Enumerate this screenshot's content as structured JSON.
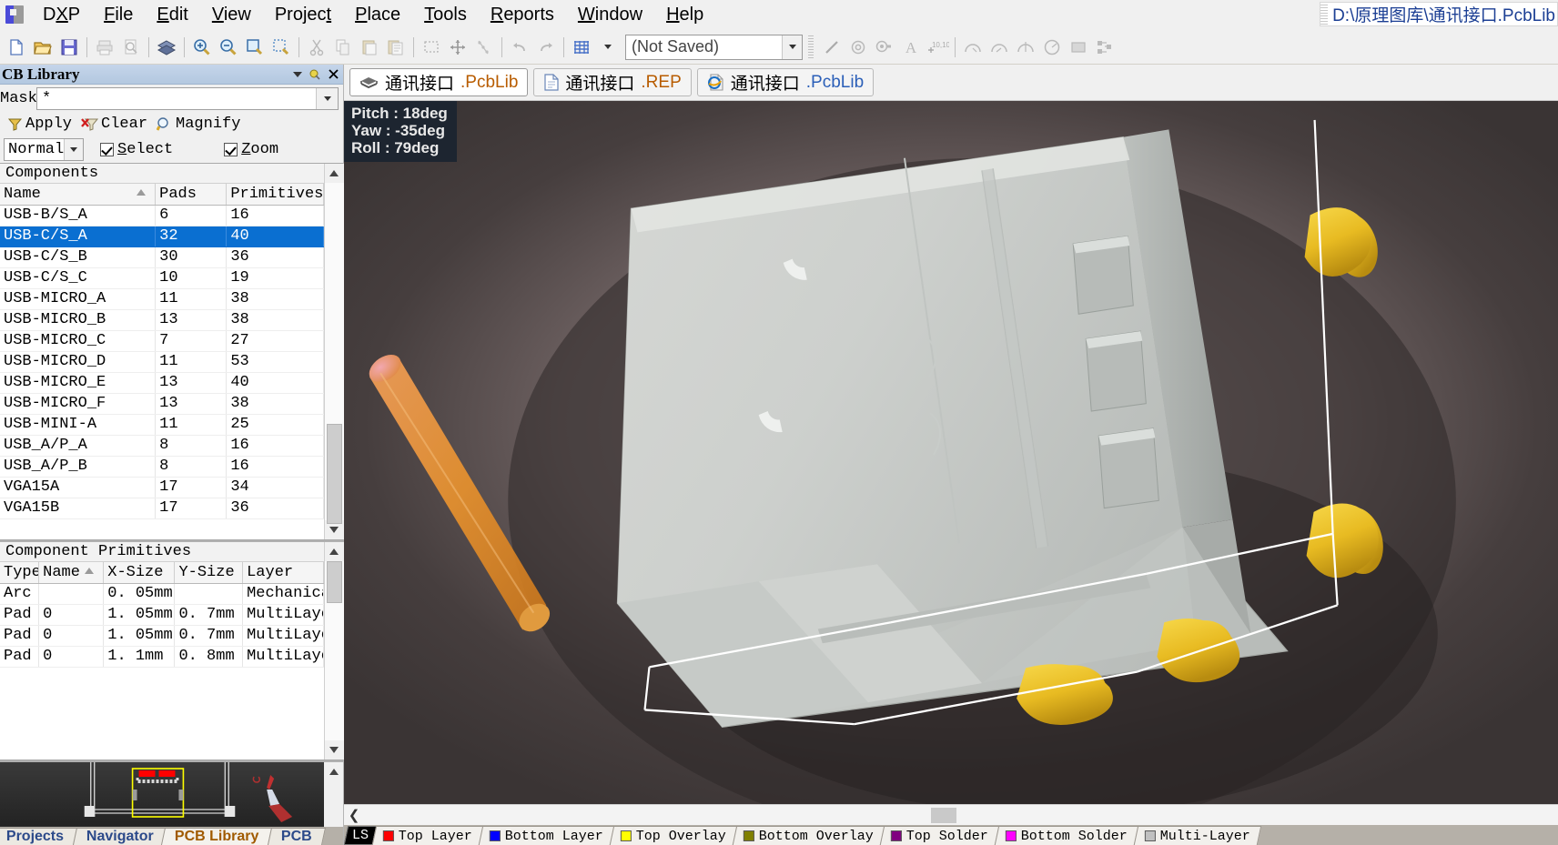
{
  "window": {
    "file_path": "D:\\原理图库\\通讯接口.PcbLib"
  },
  "menu": {
    "items": [
      "DXP",
      "File",
      "Edit",
      "View",
      "Project",
      "Place",
      "Tools",
      "Reports",
      "Window",
      "Help"
    ]
  },
  "toolbar": {
    "layer_combo_value": "(Not Saved)",
    "icons": [
      "new-document-icon",
      "open-folder-icon",
      "save-icon",
      "print-icon",
      "print-preview-icon",
      "board-3d-icon",
      "zoom-in-icon",
      "zoom-out-icon",
      "zoom-area-icon",
      "zoom-selection-icon",
      "cut-icon",
      "copy-icon",
      "paste-icon",
      "paste-special-icon",
      "select-area-icon",
      "move-icon",
      "align-icon",
      "undo-icon",
      "redo-icon",
      "grid-icon",
      "line-icon",
      "via-icon",
      "pad-icon",
      "text-icon",
      "coordinate-icon",
      "arc-center-icon",
      "arc-edge-icon",
      "arc-any-angle-icon",
      "full-circle-icon",
      "fill-icon",
      "array-paste-icon"
    ]
  },
  "panel": {
    "title": "CB Library",
    "mask": {
      "label": "Mask",
      "value": "*"
    },
    "buttons": [
      {
        "label": "Apply",
        "icon": "filter-icon"
      },
      {
        "label": "Clear",
        "icon": "clear-filter-icon"
      },
      {
        "label": "Magnify",
        "icon": "magnify-icon"
      }
    ],
    "mode_combo_value": "Normal",
    "checkboxes": [
      {
        "label": "Select",
        "checked": true
      },
      {
        "label": "Zoom",
        "checked": true
      }
    ],
    "components_grid": {
      "caption": "Components",
      "columns": [
        "Name",
        "Pads",
        "Primitives"
      ],
      "sorted_column": "Name",
      "selected_index": 1,
      "rows": [
        {
          "name": "USB-B/S_A",
          "pads": "6",
          "primitives": "16"
        },
        {
          "name": "USB-C/S_A",
          "pads": "32",
          "primitives": "40"
        },
        {
          "name": "USB-C/S_B",
          "pads": "30",
          "primitives": "36"
        },
        {
          "name": "USB-C/S_C",
          "pads": "10",
          "primitives": "19"
        },
        {
          "name": "USB-MICRO_A",
          "pads": "11",
          "primitives": "38"
        },
        {
          "name": "USB-MICRO_B",
          "pads": "13",
          "primitives": "38"
        },
        {
          "name": "USB-MICRO_C",
          "pads": "7",
          "primitives": "27"
        },
        {
          "name": "USB-MICRO_D",
          "pads": "11",
          "primitives": "53"
        },
        {
          "name": "USB-MICRO_E",
          "pads": "13",
          "primitives": "40"
        },
        {
          "name": "USB-MICRO_F",
          "pads": "13",
          "primitives": "38"
        },
        {
          "name": "USB-MINI-A",
          "pads": "11",
          "primitives": "25"
        },
        {
          "name": "USB_A/P_A",
          "pads": "8",
          "primitives": "16"
        },
        {
          "name": "USB_A/P_B",
          "pads": "8",
          "primitives": "16"
        },
        {
          "name": "VGA15A",
          "pads": "17",
          "primitives": "34"
        },
        {
          "name": "VGA15B",
          "pads": "17",
          "primitives": "36"
        }
      ]
    },
    "primitives_grid": {
      "caption": "Component Primitives",
      "columns": [
        "Type",
        "Name",
        "X-Size",
        "Y-Size",
        "Layer"
      ],
      "sorted_column": "Name",
      "rows": [
        {
          "type": "Arc",
          "name": "",
          "x": "0. 05mm",
          "y": "",
          "layer": "Mechanica"
        },
        {
          "type": "Pad",
          "name": "0",
          "x": "1. 05mm",
          "y": "0. 7mm",
          "layer": "MultiLaye"
        },
        {
          "type": "Pad",
          "name": "0",
          "x": "1. 05mm",
          "y": "0. 7mm",
          "layer": "MultiLaye"
        },
        {
          "type": "Pad",
          "name": "0",
          "x": "1. 1mm",
          "y": "0. 8mm",
          "layer": "MultiLaye"
        }
      ]
    },
    "bottom_tabs": [
      {
        "label": "Projects",
        "active": false
      },
      {
        "label": "Navigator",
        "active": false
      },
      {
        "label": "PCB Library",
        "active": true
      },
      {
        "label": "PCB",
        "active": false
      }
    ]
  },
  "documents": {
    "tabs": [
      {
        "name": "通讯接口",
        "ext": ".PcbLib",
        "icon": "pcblib-icon",
        "active": true,
        "ext_color": "orange"
      },
      {
        "name": "通讯接口",
        "ext": ".REP",
        "icon": "report-document-icon",
        "active": false,
        "ext_color": "orange"
      },
      {
        "name": "通讯接口",
        "ext": ".PcbLib",
        "icon": "browser-icon",
        "active": false,
        "ext_color": "blue"
      }
    ]
  },
  "viewport": {
    "hud": {
      "pitch": "Pitch : 18deg",
      "yaw": "Yaw : -35deg",
      "roll": "Roll : 79deg"
    }
  },
  "layer_tabs": {
    "lcd_value": "LS",
    "items": [
      {
        "label": "Top Layer",
        "color": "#ff0000"
      },
      {
        "label": "Bottom Layer",
        "color": "#0000ff"
      },
      {
        "label": "Top Overlay",
        "color": "#ffff00"
      },
      {
        "label": "Bottom Overlay",
        "color": "#808000"
      },
      {
        "label": "Top Solder",
        "color": "#800080"
      },
      {
        "label": "Bottom Solder",
        "color": "#ff00ff"
      },
      {
        "label": "Multi-Layer",
        "color": "#c0c0c0"
      }
    ]
  }
}
